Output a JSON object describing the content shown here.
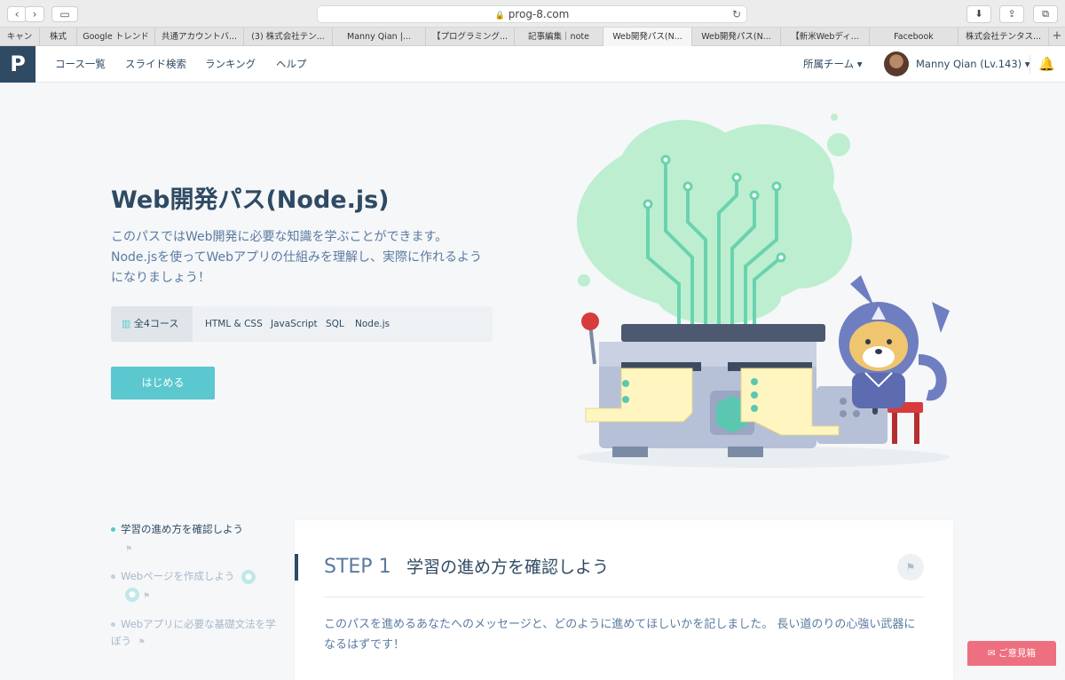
{
  "browser": {
    "url": "prog-8.com",
    "back": "‹",
    "forward": "›",
    "sidebar": "▭",
    "reload": "↻",
    "download": "⬇",
    "share": "⇪",
    "tabs_btn": "⧉",
    "tabs": [
      {
        "label": "キャン"
      },
      {
        "label": "株式"
      },
      {
        "label": "Google トレンド"
      },
      {
        "label": "共通アカウントバ..."
      },
      {
        "label": "(3) 株式会社テン..."
      },
      {
        "label": "Manny Qian |..."
      },
      {
        "label": "【プログラミング..."
      },
      {
        "label": "記事編集｜note"
      },
      {
        "label": "Web開発パス(N..."
      },
      {
        "label": "Web開発パス(N..."
      },
      {
        "label": "【新米Webディ..."
      },
      {
        "label": "Facebook"
      },
      {
        "label": "株式会社テンタス..."
      }
    ],
    "new_tab": "+"
  },
  "header": {
    "logo": "P",
    "nav": [
      "コース一覧",
      "スライド検索",
      "ランキング",
      "ヘルプ"
    ],
    "team": "所属チーム ▾",
    "user": "Manny Qian (Lv.143) ▾",
    "bell": "🔔"
  },
  "hero": {
    "title": "Web開発パス(Node.js)",
    "description": "このパスではWeb開発に必要な知識を学ぶことができます。 Node.jsを使ってWebアプリの仕組みを理解し、実際に作れるようになりましょう！",
    "course_count": "全4コース",
    "courses": [
      "HTML & CSS",
      "JavaScript",
      "SQL",
      "Node.js"
    ],
    "start_button": "はじめる"
  },
  "sidebar": {
    "items": [
      {
        "label": "学習の進め方を確認しよう"
      },
      {
        "label": "Webページを作成しよう"
      },
      {
        "label": "Webアプリに必要な基礎文法を学ぼう"
      }
    ]
  },
  "step": {
    "label": "STEP 1",
    "title": "学習の進め方を確認しよう",
    "description": "このパスを進めるあなたへのメッセージと、どのように進めてほしいかを記しました。 長い道のりの心強い武器になるはずです！"
  },
  "feedback": "✉ ご意見箱",
  "colors": {
    "primary": "#2f4a63",
    "accent": "#5bc7cf",
    "feedback": "#ee6f7f"
  }
}
